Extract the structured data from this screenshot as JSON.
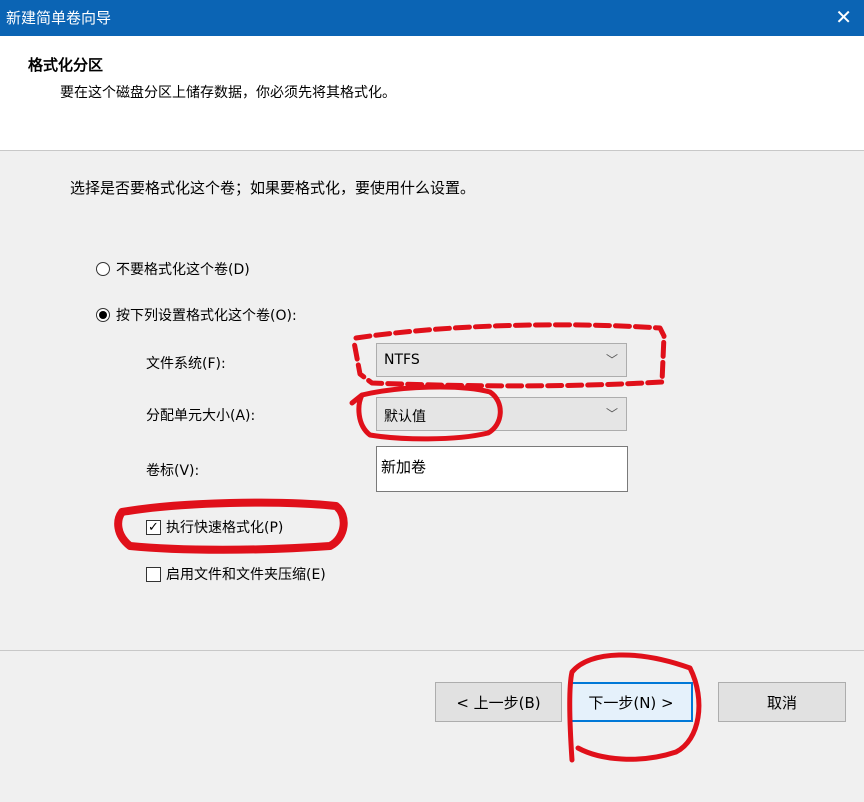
{
  "window": {
    "title": "新建简单卷向导",
    "close_glyph": "✕"
  },
  "header": {
    "title": "格式化分区",
    "subtitle": "要在这个磁盘分区上储存数据，你必须先将其格式化。"
  },
  "prompt": "选择是否要格式化这个卷；如果要格式化，要使用什么设置。",
  "options": {
    "no_format": {
      "label": "不要格式化这个卷(D)",
      "selected": false
    },
    "format": {
      "label": "按下列设置格式化这个卷(O):",
      "selected": true
    }
  },
  "fields": {
    "filesystem": {
      "label": "文件系统(F):",
      "value": "NTFS"
    },
    "allocation": {
      "label": "分配单元大小(A):",
      "value": "默认值"
    },
    "volume_label": {
      "label": "卷标(V):",
      "value": "新加卷"
    }
  },
  "checkboxes": {
    "quick_format": {
      "label": "执行快速格式化(P)",
      "checked": true
    },
    "compression": {
      "label": "启用文件和文件夹压缩(E)",
      "checked": false
    }
  },
  "buttons": {
    "back": "< 上一步(B)",
    "next": "下一步(N) >",
    "cancel": "取消"
  },
  "annotation_color": "#e0101a"
}
